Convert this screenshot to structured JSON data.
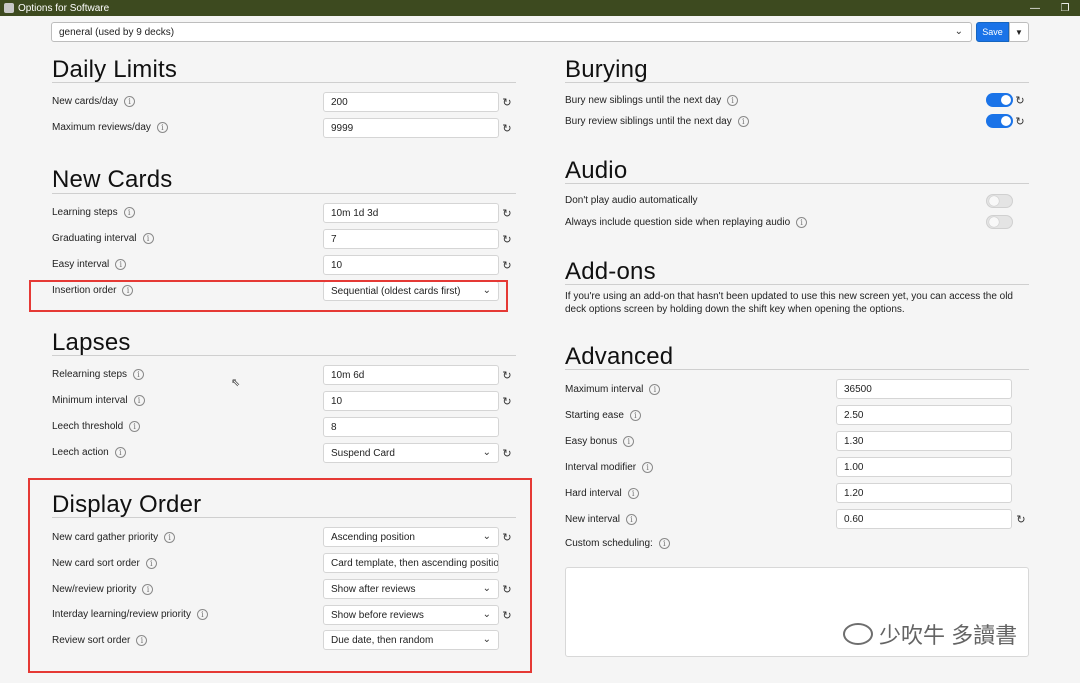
{
  "window": {
    "title": "Options for Software"
  },
  "toolbar": {
    "preset": "general (used by 9 decks)",
    "save_label": "Save"
  },
  "daily_limits": {
    "title": "Daily Limits",
    "rows": [
      {
        "label": "New cards/day",
        "value": "200"
      },
      {
        "label": "Maximum reviews/day",
        "value": "9999"
      }
    ]
  },
  "new_cards": {
    "title": "New Cards",
    "rows": [
      {
        "label": "Learning steps",
        "value": "10m 1d 3d"
      },
      {
        "label": "Graduating interval",
        "value": "7"
      },
      {
        "label": "Easy interval",
        "value": "10"
      },
      {
        "label": "Insertion order",
        "value": "Sequential (oldest cards first)"
      }
    ]
  },
  "lapses": {
    "title": "Lapses",
    "rows": [
      {
        "label": "Relearning steps",
        "value": "10m 6d"
      },
      {
        "label": "Minimum interval",
        "value": "10"
      },
      {
        "label": "Leech threshold",
        "value": "8"
      },
      {
        "label": "Leech action",
        "value": "Suspend Card"
      }
    ]
  },
  "display_order": {
    "title": "Display Order",
    "rows": [
      {
        "label": "New card gather priority",
        "value": "Ascending position"
      },
      {
        "label": "New card sort order",
        "value": "Card template, then ascending position"
      },
      {
        "label": "New/review priority",
        "value": "Show after reviews"
      },
      {
        "label": "Interday learning/review priority",
        "value": "Show before reviews"
      },
      {
        "label": "Review sort order",
        "value": "Due date, then random"
      }
    ]
  },
  "burying": {
    "title": "Burying",
    "rows": [
      {
        "label": "Bury new siblings until the next day",
        "on": true
      },
      {
        "label": "Bury review siblings until the next day",
        "on": true
      }
    ]
  },
  "audio": {
    "title": "Audio",
    "rows": [
      {
        "label": "Don't play audio automatically",
        "on": false
      },
      {
        "label": "Always include question side when replaying audio",
        "on": false
      }
    ]
  },
  "addons": {
    "title": "Add-ons",
    "text": "If you're using an add-on that hasn't been updated to use this new screen yet, you can access the old deck options screen by holding down the shift key when opening the options."
  },
  "advanced": {
    "title": "Advanced",
    "rows": [
      {
        "label": "Maximum interval",
        "value": "36500"
      },
      {
        "label": "Starting ease",
        "value": "2.50"
      },
      {
        "label": "Easy bonus",
        "value": "1.30"
      },
      {
        "label": "Interval modifier",
        "value": "1.00"
      },
      {
        "label": "Hard interval",
        "value": "1.20"
      },
      {
        "label": "New interval",
        "value": "0.60"
      },
      {
        "label": "Custom scheduling:"
      }
    ]
  },
  "watermark": {
    "text": "少吹牛 多讀書"
  },
  "icons": {
    "info": "info-icon",
    "revert": "revert-icon",
    "dropdown": "chevron-down-icon",
    "app": "app-icon",
    "minimize": "minimize-icon",
    "restore": "restore-icon",
    "cursor": "mouse-cursor-icon",
    "wechat": "wechat-icon"
  },
  "colors": {
    "accent": "#1a73e8",
    "highlight": "#e53935",
    "titlebar": "#3d4a1f"
  }
}
